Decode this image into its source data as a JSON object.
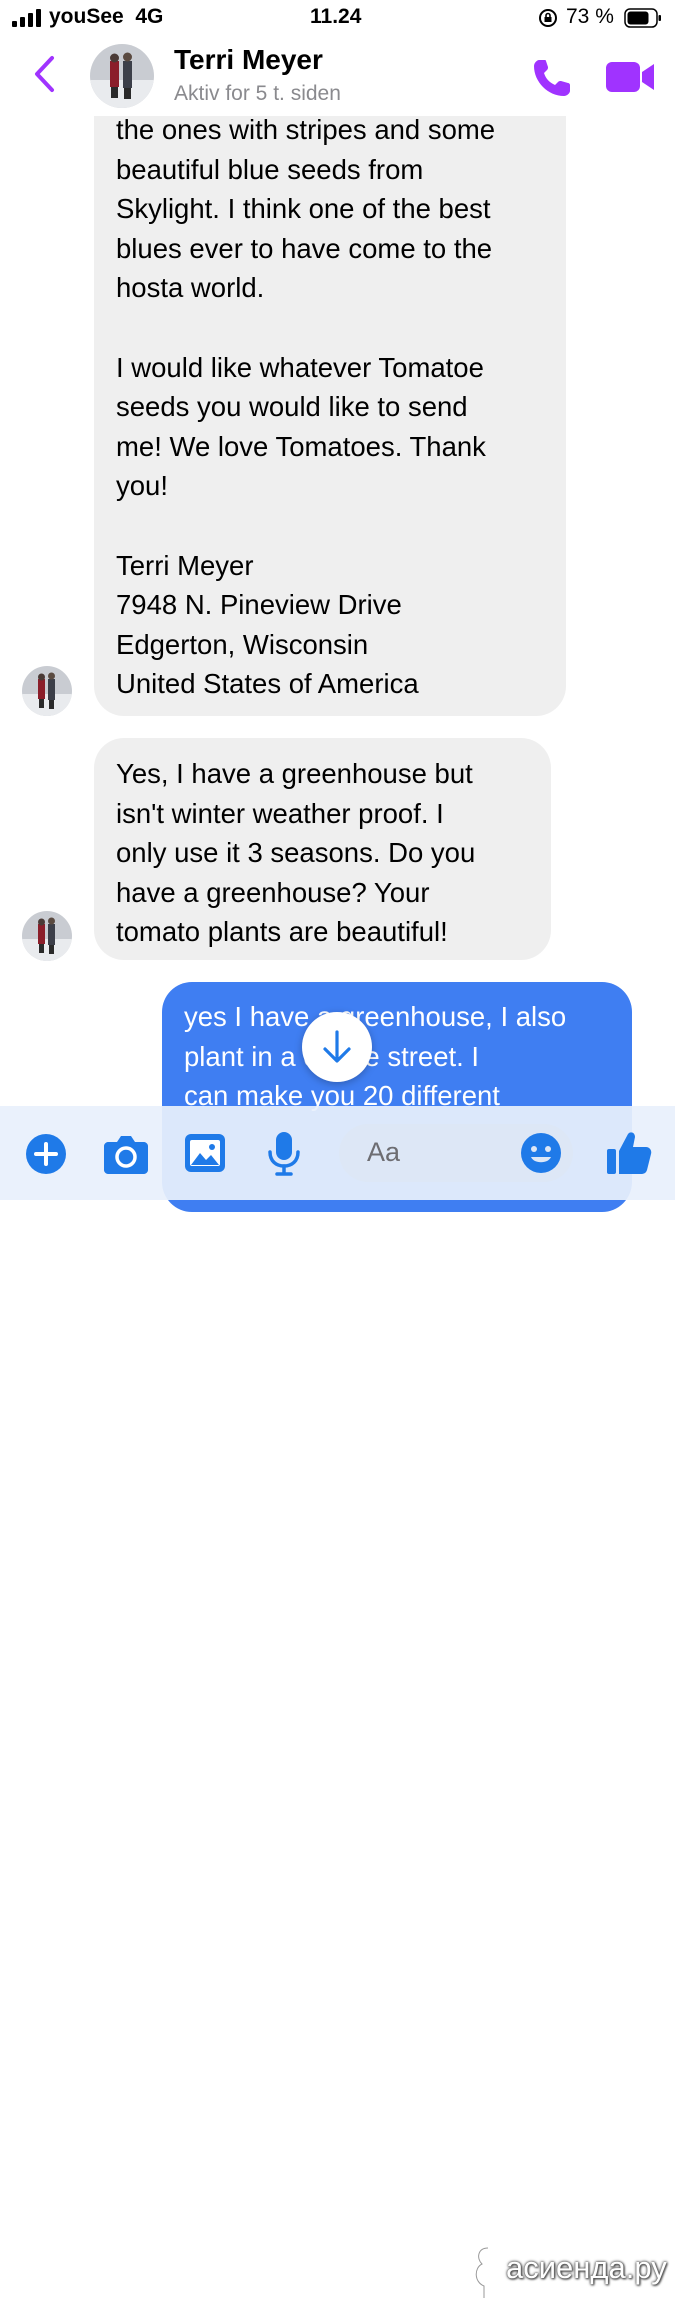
{
  "status_bar": {
    "carrier": "youSee",
    "network": "4G",
    "time": "11.24",
    "battery": "73 %"
  },
  "header": {
    "name": "Terri Meyer",
    "status": "Aktiv for 5 t. siden"
  },
  "messages": [
    {
      "direction": "incoming",
      "lines": [
        "the ones with stripes and some",
        "beautiful blue seeds from",
        "Skylight. I think one of the best",
        "blues ever to have come to the",
        "hosta world.",
        "",
        "I would like whatever Tomatoe",
        "seeds you would like to send",
        "me! We love Tomatoes. Thank",
        "you!",
        "",
        "Terri Meyer",
        "7948 N. Pineview Drive",
        "Edgerton,  Wisconsin",
        "United States of America"
      ]
    },
    {
      "direction": "incoming",
      "lines": [
        "Yes, I have a greenhouse but",
        "isn't winter weather proof. I",
        "only use it 3 seasons.  Do you",
        "have a greenhouse? Your",
        "tomato plants are beautiful!"
      ]
    },
    {
      "direction": "outgoing",
      "lines": [
        "yes I have a greenhouse, I also",
        "plant in a      on the street. I",
        "can make you 20 different"
      ]
    }
  ],
  "composer": {
    "placeholder": "Aa"
  },
  "watermark": "асиенда.ру",
  "colors": {
    "accent": "#a033ff",
    "outgoing_bubble": "#3f7ef2",
    "incoming_bubble": "#efefef",
    "composer_icons": "#1f7ae8"
  },
  "icons": [
    "signal-icon",
    "rotation-lock-icon",
    "battery-icon",
    "back-chevron-icon",
    "phone-icon",
    "video-camera-icon",
    "scroll-down-arrow-icon",
    "plus-icon",
    "camera-icon",
    "image-icon",
    "microphone-icon",
    "emoji-icon",
    "thumbs-up-icon"
  ]
}
